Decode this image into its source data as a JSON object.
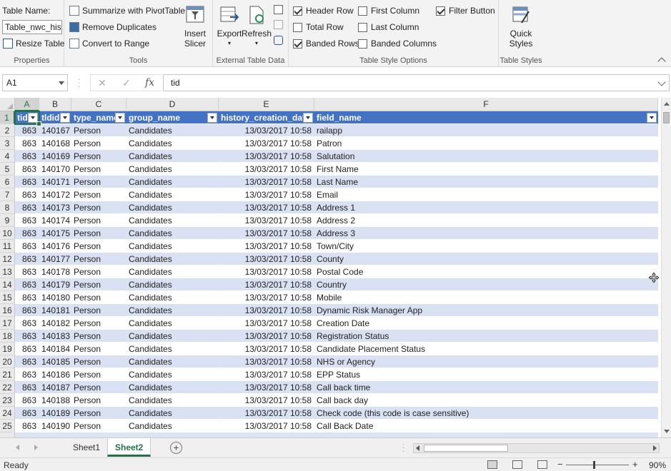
{
  "ribbon": {
    "properties": {
      "table_name_label": "Table Name:",
      "table_name_value": "Table_nwc_histo",
      "resize_label": "Resize Table",
      "group_label": "Properties"
    },
    "tools": {
      "summarize_label": "Summarize with PivotTable",
      "remove_dup_label": "Remove Duplicates",
      "convert_label": "Convert to Range",
      "insert_slicer_label_1": "Insert",
      "insert_slicer_label_2": "Slicer",
      "group_label": "Tools"
    },
    "external": {
      "export_label": "Export",
      "refresh_label": "Refresh",
      "group_label": "External Table Data"
    },
    "style_options": {
      "header_row": "Header Row",
      "total_row": "Total Row",
      "banded_rows": "Banded Rows",
      "first_column": "First Column",
      "last_column": "Last Column",
      "banded_columns": "Banded Columns",
      "filter_button": "Filter Button",
      "group_label": "Table Style Options"
    },
    "styles": {
      "quick_1": "Quick",
      "quick_2": "Styles",
      "group_label": "Table Styles"
    }
  },
  "formula_bar": {
    "name_box": "A1",
    "fx": "fx",
    "value": "tid"
  },
  "grid": {
    "columns": [
      "A",
      "B",
      "C",
      "D",
      "E",
      "F"
    ],
    "header": [
      "tid",
      "tldid",
      "type_name",
      "group_name",
      "history_creation_date",
      "field_name"
    ],
    "rows": [
      {
        "n": "2",
        "tid": "863",
        "tldid": "140167",
        "type": "Person",
        "group": "Candidates",
        "date": "13/03/2017 10:58",
        "field": "railapp"
      },
      {
        "n": "3",
        "tid": "863",
        "tldid": "140168",
        "type": "Person",
        "group": "Candidates",
        "date": "13/03/2017 10:58",
        "field": "Patron"
      },
      {
        "n": "4",
        "tid": "863",
        "tldid": "140169",
        "type": "Person",
        "group": "Candidates",
        "date": "13/03/2017 10:58",
        "field": "Salutation"
      },
      {
        "n": "5",
        "tid": "863",
        "tldid": "140170",
        "type": "Person",
        "group": "Candidates",
        "date": "13/03/2017 10:58",
        "field": "First Name"
      },
      {
        "n": "6",
        "tid": "863",
        "tldid": "140171",
        "type": "Person",
        "group": "Candidates",
        "date": "13/03/2017 10:58",
        "field": "Last Name"
      },
      {
        "n": "7",
        "tid": "863",
        "tldid": "140172",
        "type": "Person",
        "group": "Candidates",
        "date": "13/03/2017 10:58",
        "field": "Email"
      },
      {
        "n": "8",
        "tid": "863",
        "tldid": "140173",
        "type": "Person",
        "group": "Candidates",
        "date": "13/03/2017 10:58",
        "field": "Address 1"
      },
      {
        "n": "9",
        "tid": "863",
        "tldid": "140174",
        "type": "Person",
        "group": "Candidates",
        "date": "13/03/2017 10:58",
        "field": "Address 2"
      },
      {
        "n": "10",
        "tid": "863",
        "tldid": "140175",
        "type": "Person",
        "group": "Candidates",
        "date": "13/03/2017 10:58",
        "field": "Address 3"
      },
      {
        "n": "11",
        "tid": "863",
        "tldid": "140176",
        "type": "Person",
        "group": "Candidates",
        "date": "13/03/2017 10:58",
        "field": "Town/City"
      },
      {
        "n": "12",
        "tid": "863",
        "tldid": "140177",
        "type": "Person",
        "group": "Candidates",
        "date": "13/03/2017 10:58",
        "field": "County"
      },
      {
        "n": "13",
        "tid": "863",
        "tldid": "140178",
        "type": "Person",
        "group": "Candidates",
        "date": "13/03/2017 10:58",
        "field": "Postal Code"
      },
      {
        "n": "14",
        "tid": "863",
        "tldid": "140179",
        "type": "Person",
        "group": "Candidates",
        "date": "13/03/2017 10:58",
        "field": "Country"
      },
      {
        "n": "15",
        "tid": "863",
        "tldid": "140180",
        "type": "Person",
        "group": "Candidates",
        "date": "13/03/2017 10:58",
        "field": "Mobile"
      },
      {
        "n": "16",
        "tid": "863",
        "tldid": "140181",
        "type": "Person",
        "group": "Candidates",
        "date": "13/03/2017 10:58",
        "field": "Dynamic Risk Manager App"
      },
      {
        "n": "17",
        "tid": "863",
        "tldid": "140182",
        "type": "Person",
        "group": "Candidates",
        "date": "13/03/2017 10:58",
        "field": "Creation Date"
      },
      {
        "n": "18",
        "tid": "863",
        "tldid": "140183",
        "type": "Person",
        "group": "Candidates",
        "date": "13/03/2017 10:58",
        "field": "Registration Status"
      },
      {
        "n": "19",
        "tid": "863",
        "tldid": "140184",
        "type": "Person",
        "group": "Candidates",
        "date": "13/03/2017 10:58",
        "field": "Candidate Placement Status"
      },
      {
        "n": "20",
        "tid": "863",
        "tldid": "140185",
        "type": "Person",
        "group": "Candidates",
        "date": "13/03/2017 10:58",
        "field": "NHS or Agency"
      },
      {
        "n": "21",
        "tid": "863",
        "tldid": "140186",
        "type": "Person",
        "group": "Candidates",
        "date": "13/03/2017 10:58",
        "field": "EPP Status"
      },
      {
        "n": "22",
        "tid": "863",
        "tldid": "140187",
        "type": "Person",
        "group": "Candidates",
        "date": "13/03/2017 10:58",
        "field": "Call back time"
      },
      {
        "n": "23",
        "tid": "863",
        "tldid": "140188",
        "type": "Person",
        "group": "Candidates",
        "date": "13/03/2017 10:58",
        "field": "Call back day"
      },
      {
        "n": "24",
        "tid": "863",
        "tldid": "140189",
        "type": "Person",
        "group": "Candidates",
        "date": "13/03/2017 10:58",
        "field": "Check code (this code is case sensitive)"
      },
      {
        "n": "25",
        "tid": "863",
        "tldid": "140190",
        "type": "Person",
        "group": "Candidates",
        "date": "13/03/2017 10:58",
        "field": "Call Back Date"
      }
    ]
  },
  "sheets": {
    "tabs": [
      "Sheet1",
      "Sheet2"
    ],
    "active": "Sheet2",
    "add_symbol": "+"
  },
  "status": {
    "ready": "Ready",
    "zoom_minus": "−",
    "zoom_plus": "+",
    "zoom": "90%"
  },
  "colors": {
    "accent": "#217346",
    "table_header": "#4472c4",
    "band": "#d9e1f2"
  }
}
